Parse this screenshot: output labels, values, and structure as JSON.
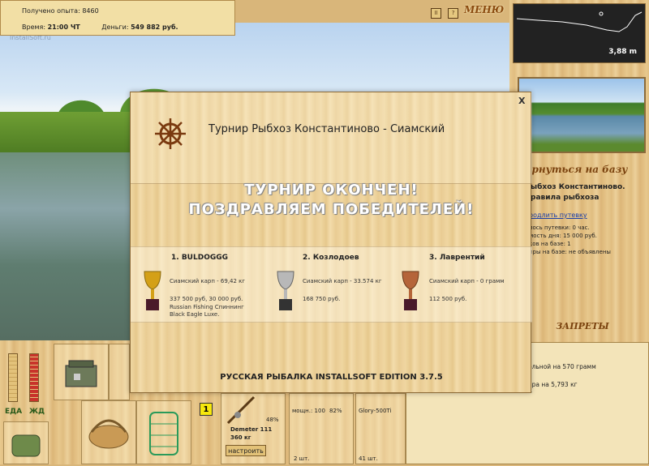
{
  "infobar": {
    "experience": "Получено опыта: 8460",
    "time_label": "Время:",
    "time_value": "21:00 ЧТ",
    "money_label": "Деньги:",
    "money_value": "549 882 руб."
  },
  "watermark": "InstallSoft.ru",
  "topbar": {
    "pause": "II",
    "help": "?",
    "menu": "МЕНЮ"
  },
  "depth": {
    "value": "3,88 m"
  },
  "right": {
    "return_label": "вернуться на базу",
    "base_title_1": "ыбхоз Константиново.",
    "base_title_2": "равила рыбхоза",
    "extend_link": "родлить путевку",
    "info": [
      "лось путевки: 0 час.",
      "мость дня: 15 000 руб.",
      "ков на базе: 1",
      "иры на базе: не объявлены"
    ],
    "bans_label": "ЗАПРЕТЫ"
  },
  "log": [
    "ольной на 570 грамм",
    "",
    "ара на 5,793 кг",
    "⌃"
  ],
  "bottom": {
    "food_label": "ЕДА",
    "drink_label": "ЖД",
    "badge": "1",
    "percent": "48%",
    "rod_name": "Demeter 111",
    "rod_weight": "360 кг",
    "set_button": "настроить",
    "power_label": "мощн.: 100",
    "power_pct": "82%",
    "line_name": "Glory-500Ti",
    "qty1": "2 шт.",
    "qty2": "41 шт."
  },
  "modal": {
    "title": "Турнир Рыбхоз Константиново - Сиамский",
    "close": "X",
    "over_line1": "ТУРНИР ОКОНЧЕН!",
    "over_line2": "ПОЗДРАВЛЯЕМ ПОБЕДИТЕЛЕЙ!",
    "places": [
      {
        "name": "1. BULDOGGG",
        "fish": "Сиамский карп - 69,42 кг",
        "prize": "337 500 руб, 30 000 руб.",
        "extra1": "Russian Fishing Спиннинг",
        "extra2": "Black Eagle Luxe."
      },
      {
        "name": "2. Козлодоев",
        "fish": "Сиамский карп - 33.574 кг",
        "prize": "168 750 руб."
      },
      {
        "name": "3. Лаврентий",
        "fish": "Сиамский карп - 0 грамм",
        "prize": "112 500 руб."
      }
    ],
    "footer": "РУССКАЯ РЫБАЛКА INSTALLSOFT EDITION 3.7.5"
  },
  "colors": {
    "gold": "#d4a017",
    "silver": "#b8b8b8",
    "bronze": "#b5653a",
    "wood": "#e8c98e"
  }
}
